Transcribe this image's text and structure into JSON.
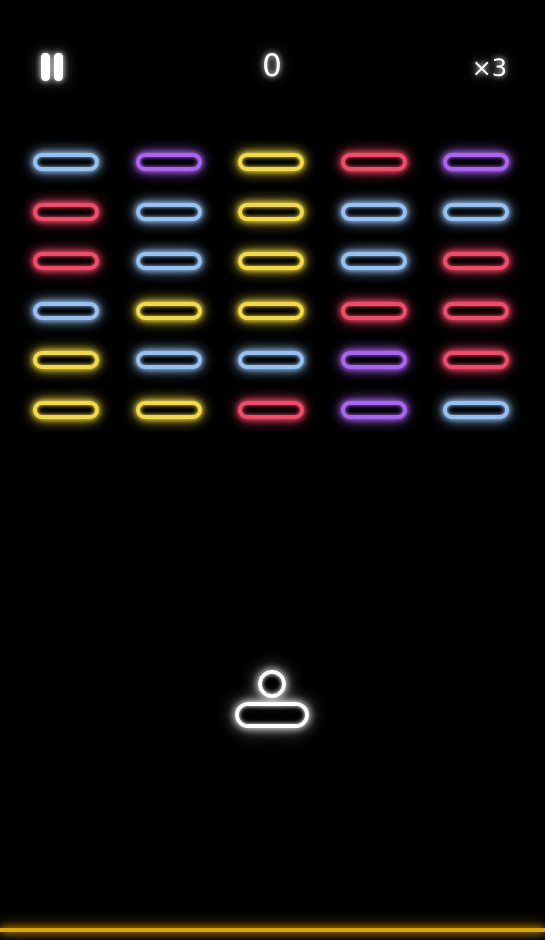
{
  "hud": {
    "pause_icon": "pause-icon",
    "score": "0",
    "lives": "×3"
  },
  "colors": {
    "blue": "#9ecbff",
    "purple": "#b36bff",
    "yellow": "#ffe54a",
    "red": "#ff4f6f",
    "white": "#ffffff",
    "floor": "#e0a400"
  },
  "bricks": [
    [
      "blue",
      "purple",
      "yellow",
      "red",
      "purple"
    ],
    [
      "red",
      "blue",
      "yellow",
      "blue",
      "blue"
    ],
    [
      "red",
      "blue",
      "yellow",
      "blue",
      "red"
    ],
    [
      "blue",
      "yellow",
      "yellow",
      "red",
      "red"
    ],
    [
      "yellow",
      "blue",
      "blue",
      "purple",
      "red"
    ],
    [
      "yellow",
      "yellow",
      "red",
      "purple",
      "blue"
    ]
  ]
}
